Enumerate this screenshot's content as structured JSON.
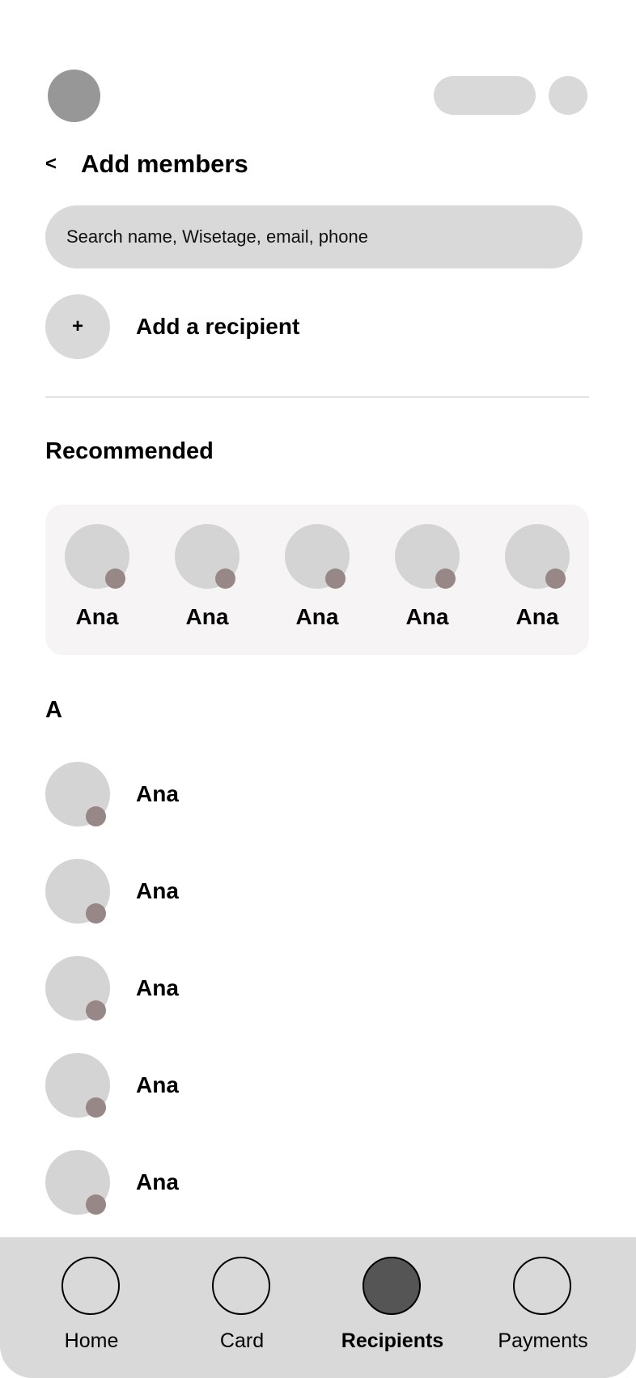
{
  "header": {
    "back_label": "<",
    "title": "Add members"
  },
  "search": {
    "placeholder": "Search name, Wisetage, email, phone",
    "value": ""
  },
  "add_recipient": {
    "icon": "+",
    "label": "Add a recipient"
  },
  "recommended": {
    "heading": "Recommended",
    "items": [
      {
        "name": "Ana"
      },
      {
        "name": "Ana"
      },
      {
        "name": "Ana"
      },
      {
        "name": "Ana"
      },
      {
        "name": "Ana"
      }
    ]
  },
  "contacts": {
    "letter": "A",
    "items": [
      {
        "name": "Ana"
      },
      {
        "name": "Ana"
      },
      {
        "name": "Ana"
      },
      {
        "name": "Ana"
      },
      {
        "name": "Ana"
      }
    ]
  },
  "nav": {
    "items": [
      {
        "label": "Home",
        "active": false
      },
      {
        "label": "Card",
        "active": false
      },
      {
        "label": "Recipients",
        "active": true
      },
      {
        "label": "Payments",
        "active": false
      }
    ]
  },
  "colors": {
    "placeholder_gray": "#d9d9d9",
    "avatar_gray": "#d4d4d4",
    "status_dot": "#978786",
    "panel_bg": "#f6f4f5",
    "active_nav": "#555555"
  }
}
